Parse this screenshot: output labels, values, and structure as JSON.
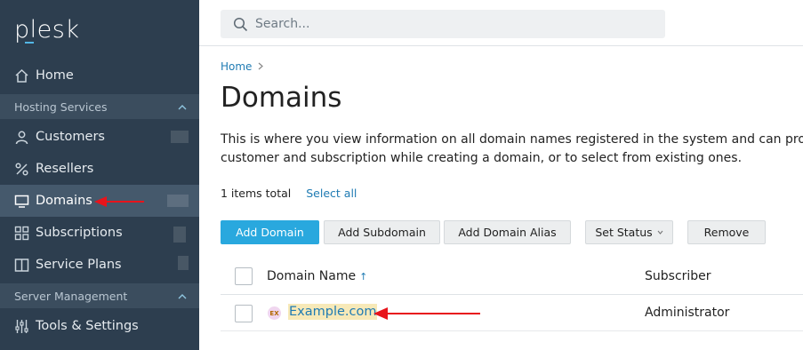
{
  "app": {
    "logo": "plesk"
  },
  "sidebar": {
    "items": [
      {
        "label": "Home",
        "icon": "home-icon"
      },
      {
        "label": "Hosting Services",
        "section": true
      },
      {
        "label": "Customers",
        "icon": "user-icon"
      },
      {
        "label": "Resellers",
        "icon": "percent-icon"
      },
      {
        "label": "Domains",
        "icon": "monitor-icon",
        "active": true
      },
      {
        "label": "Subscriptions",
        "icon": "grid-icon"
      },
      {
        "label": "Service Plans",
        "icon": "book-icon"
      },
      {
        "label": "Server Management",
        "section": true
      },
      {
        "label": "Tools & Settings",
        "icon": "sliders-icon"
      }
    ]
  },
  "search": {
    "placeholder": "Search..."
  },
  "breadcrumb": {
    "home": "Home"
  },
  "page": {
    "title": "Domains",
    "description_line1": "This is where you view information on all domain names registered in the system and can proceed to",
    "description_line2": "customer and subscription while creating a domain, or to select from existing ones."
  },
  "list": {
    "total": "1 items total",
    "select_all": "Select all"
  },
  "toolbar": {
    "add_domain": "Add Domain",
    "add_subdomain": "Add Subdomain",
    "add_domain_alias": "Add Domain Alias",
    "set_status": "Set Status",
    "remove": "Remove"
  },
  "table": {
    "columns": [
      "Domain Name",
      "Subscriber"
    ],
    "rows": [
      {
        "domain": "Example.com",
        "icon_text": "EX",
        "subscriber": "Administrator"
      }
    ]
  },
  "colors": {
    "sidebar_bg": "#2d3e4f",
    "accent": "#29a8de",
    "annotation": "#e8141b"
  }
}
